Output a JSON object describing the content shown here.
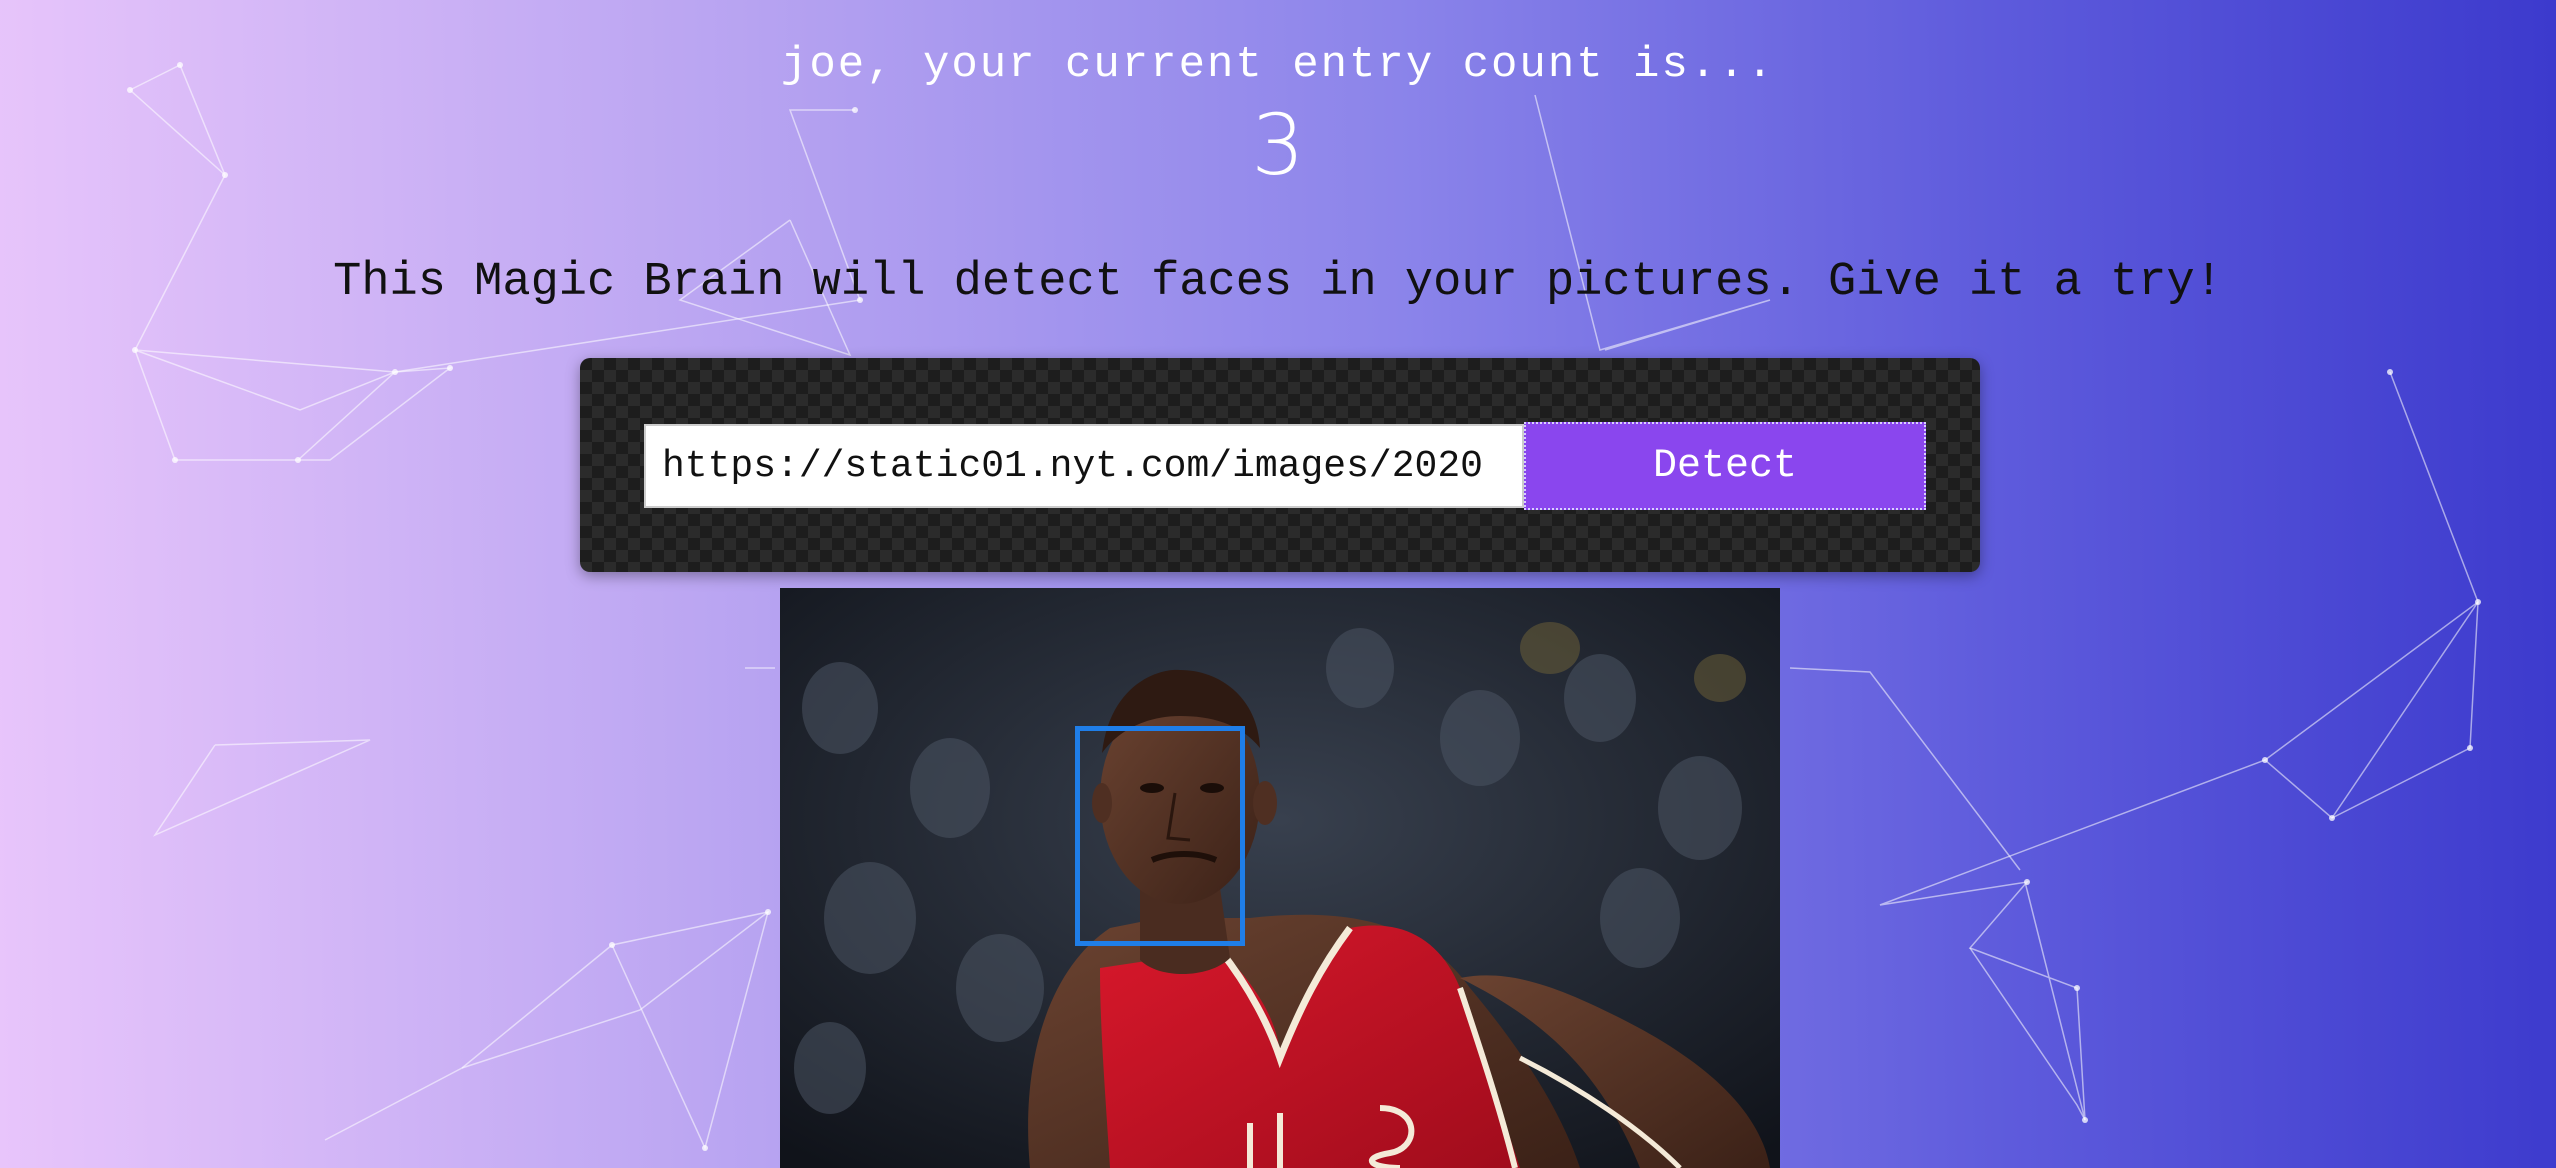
{
  "rank": {
    "line": "joe, your current entry count is...",
    "value": "3"
  },
  "tagline": "This Magic Brain will detect faces in your pictures. Give it a try!",
  "form": {
    "url_value": "https://static01.nyt.com/images/2020",
    "button_label": "Detect"
  },
  "colors": {
    "button": "#8a46ee",
    "face_box": "#1f7ee8",
    "gradient_left": "#e8c5fb",
    "gradient_right": "#3c3acd"
  }
}
